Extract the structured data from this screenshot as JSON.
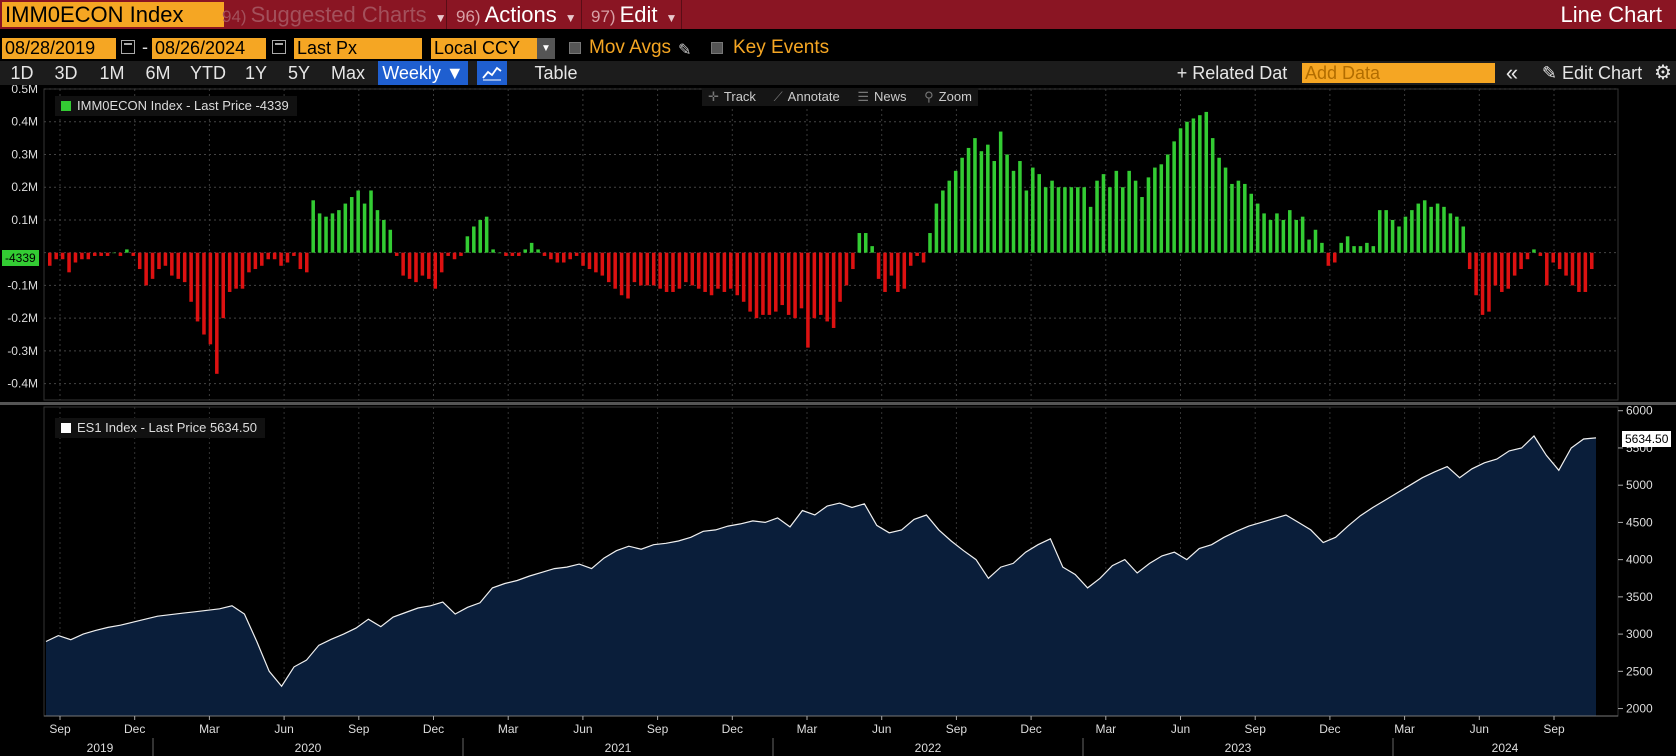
{
  "header": {
    "security": "IMM0ECON Index",
    "menus": [
      {
        "num": "94)",
        "label": "Suggested Charts",
        "dim": true
      },
      {
        "num": "96)",
        "label": "Actions",
        "dim": false
      },
      {
        "num": "97)",
        "label": "Edit",
        "dim": false
      }
    ],
    "view_title": "Line Chart"
  },
  "controls": {
    "start_date": "08/28/2019",
    "dash": "-",
    "end_date": "08/26/2024",
    "field": "Last Px",
    "currency": "Local CCY",
    "mov_avgs": "Mov Avgs",
    "key_events": "Key Events"
  },
  "toolbar": {
    "ranges": [
      "1D",
      "3D",
      "1M",
      "6M",
      "YTD",
      "1Y",
      "5Y",
      "Max"
    ],
    "frequency": "Weekly ▼",
    "table": "Table",
    "related_data": "+ Related Dat",
    "add_data_placeholder": "Add Data",
    "collapse": "«",
    "edit_chart": "Edit Chart"
  },
  "chart_tools": [
    "Track",
    "Annotate",
    "News",
    "Zoom"
  ],
  "colors": {
    "header_bg": "#8a1523",
    "accent_orange": "#f5a623",
    "positive_bar": "#33cc33",
    "negative_bar": "#dd1111",
    "area_fill": "#0a1e3a",
    "active_blue": "#1f5fd0"
  },
  "chart_data": [
    {
      "type": "bar",
      "legend": "IMM0ECON Index - Last Price -4339",
      "last_value_tag": "-4339",
      "y_ticks": [
        "0.5M",
        "0.4M",
        "0.3M",
        "0.2M",
        "0.1M",
        "0",
        "-0.1M",
        "-0.2M",
        "-0.3M",
        "-0.4M"
      ],
      "ylim": [
        -0.45,
        0.5
      ],
      "unit": "M",
      "values": [
        -0.04,
        -0.02,
        -0.02,
        -0.06,
        -0.03,
        -0.02,
        -0.02,
        -0.01,
        -0.01,
        -0.01,
        0,
        -0.01,
        0.01,
        -0.01,
        -0.05,
        -0.1,
        -0.08,
        -0.05,
        -0.04,
        -0.07,
        -0.08,
        -0.09,
        -0.15,
        -0.21,
        -0.25,
        -0.28,
        -0.37,
        -0.2,
        -0.12,
        -0.11,
        -0.11,
        -0.06,
        -0.05,
        -0.04,
        -0.02,
        -0.02,
        -0.04,
        -0.03,
        -0.01,
        -0.05,
        -0.06,
        0.16,
        0.12,
        0.11,
        0.12,
        0.13,
        0.15,
        0.17,
        0.19,
        0.15,
        0.19,
        0.13,
        0.1,
        0.07,
        -0.01,
        -0.07,
        -0.08,
        -0.09,
        -0.07,
        -0.08,
        -0.11,
        -0.06,
        -0.01,
        -0.02,
        -0.01,
        0.05,
        0.08,
        0.1,
        0.11,
        0.01,
        0,
        -0.01,
        -0.01,
        -0.01,
        0.01,
        0.03,
        0.01,
        -0.01,
        -0.02,
        -0.03,
        -0.03,
        -0.02,
        -0.01,
        -0.04,
        -0.05,
        -0.06,
        -0.07,
        -0.09,
        -0.11,
        -0.13,
        -0.14,
        -0.09,
        -0.1,
        -0.1,
        -0.1,
        -0.11,
        -0.12,
        -0.12,
        -0.11,
        -0.09,
        -0.1,
        -0.11,
        -0.12,
        -0.13,
        -0.11,
        -0.12,
        -0.11,
        -0.13,
        -0.15,
        -0.18,
        -0.2,
        -0.19,
        -0.19,
        -0.18,
        -0.16,
        -0.19,
        -0.2,
        -0.17,
        -0.29,
        -0.2,
        -0.19,
        -0.21,
        -0.23,
        -0.15,
        -0.1,
        -0.05,
        0.06,
        0.06,
        0.02,
        -0.08,
        -0.12,
        -0.07,
        -0.12,
        -0.11,
        -0.04,
        -0.01,
        -0.03,
        0.06,
        0.15,
        0.19,
        0.22,
        0.25,
        0.29,
        0.32,
        0.35,
        0.31,
        0.33,
        0.28,
        0.37,
        0.3,
        0.25,
        0.28,
        0.19,
        0.26,
        0.24,
        0.2,
        0.22,
        0.2,
        0.2,
        0.2,
        0.2,
        0.2,
        0.14,
        0.22,
        0.24,
        0.2,
        0.25,
        0.2,
        0.25,
        0.22,
        0.17,
        0.23,
        0.26,
        0.27,
        0.3,
        0.34,
        0.38,
        0.4,
        0.41,
        0.42,
        0.43,
        0.35,
        0.29,
        0.26,
        0.21,
        0.22,
        0.21,
        0.18,
        0.15,
        0.12,
        0.1,
        0.12,
        0.1,
        0.13,
        0.1,
        0.11,
        0.04,
        0.07,
        0.03,
        -0.04,
        -0.03,
        0.03,
        0.05,
        0.02,
        0.02,
        0.03,
        0.02,
        0.13,
        0.13,
        0.1,
        0.08,
        0.11,
        0.13,
        0.15,
        0.16,
        0.14,
        0.15,
        0.14,
        0.12,
        0.11,
        0.08,
        -0.05,
        -0.13,
        -0.19,
        -0.18,
        -0.1,
        -0.12,
        -0.11,
        -0.07,
        -0.05,
        -0.02,
        0.01,
        -0.01,
        -0.1,
        -0.03,
        -0.05,
        -0.07,
        -0.1,
        -0.12,
        -0.12,
        -0.05
      ]
    },
    {
      "type": "area",
      "legend": "ES1 Index - Last Price 5634.50",
      "last_value_tag": "5634.50",
      "y_ticks": [
        "6000",
        "5500",
        "5000",
        "4500",
        "4000",
        "3500",
        "3000",
        "2500",
        "2000"
      ],
      "ylim": [
        1900,
        6050
      ],
      "x_tick_months": [
        "Sep",
        "Dec",
        "Mar",
        "Jun",
        "Sep",
        "Dec",
        "Mar",
        "Jun",
        "Sep",
        "Dec",
        "Mar",
        "Jun",
        "Sep",
        "Dec",
        "Mar",
        "Jun",
        "Sep",
        "Dec",
        "Mar",
        "Jun",
        "Sep"
      ],
      "x_tick_years": [
        "2019",
        "2020",
        "2021",
        "2022",
        "2023",
        "2024"
      ],
      "values": [
        2900,
        2980,
        2925,
        3000,
        3050,
        3090,
        3120,
        3160,
        3200,
        3240,
        3260,
        3280,
        3300,
        3320,
        3340,
        3380,
        3270,
        2900,
        2500,
        2300,
        2560,
        2650,
        2850,
        2930,
        3000,
        3080,
        3200,
        3100,
        3230,
        3290,
        3350,
        3380,
        3430,
        3270,
        3360,
        3420,
        3620,
        3680,
        3720,
        3780,
        3830,
        3880,
        3900,
        3940,
        3880,
        4020,
        4120,
        4180,
        4140,
        4200,
        4220,
        4250,
        4300,
        4380,
        4400,
        4450,
        4480,
        4520,
        4500,
        4560,
        4440,
        4660,
        4600,
        4720,
        4760,
        4700,
        4750,
        4460,
        4360,
        4400,
        4540,
        4600,
        4400,
        4250,
        4120,
        4000,
        3750,
        3900,
        3950,
        4100,
        4200,
        4280,
        3900,
        3800,
        3620,
        3750,
        3920,
        4000,
        3820,
        3950,
        4050,
        4100,
        4000,
        4150,
        4200,
        4300,
        4380,
        4450,
        4500,
        4550,
        4600,
        4500,
        4400,
        4230,
        4300,
        4450,
        4590,
        4700,
        4800,
        4900,
        5000,
        5100,
        5180,
        5250,
        5100,
        5220,
        5300,
        5350,
        5460,
        5500,
        5660,
        5400,
        5200,
        5500,
        5620,
        5634.5
      ]
    }
  ]
}
